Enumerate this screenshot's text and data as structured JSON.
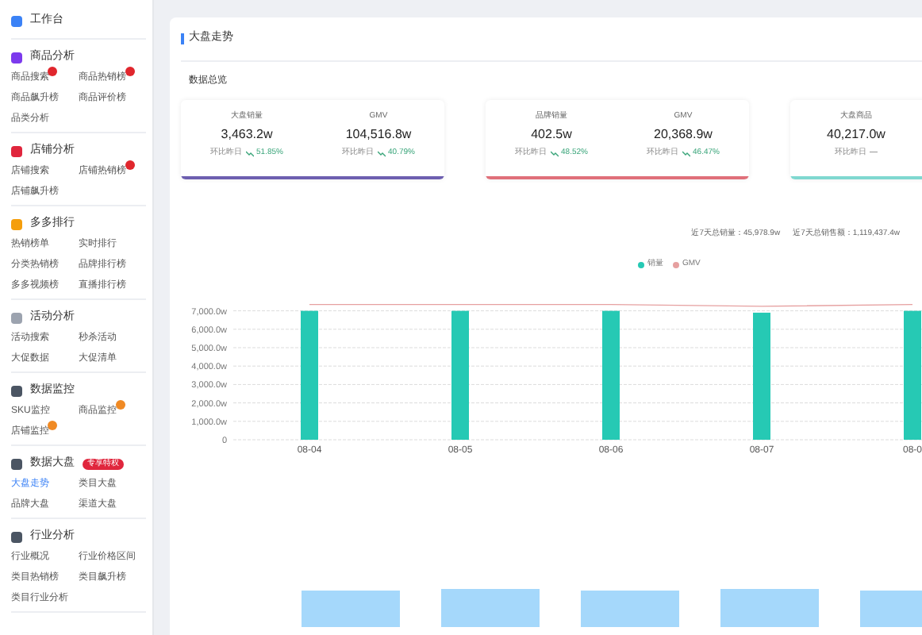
{
  "sidebar": {
    "sections": [
      {
        "title": "工作台"
      },
      {
        "title": "商品分析",
        "items": [
          {
            "label": "商品搜索",
            "selected": false,
            "color": "#e0262d"
          },
          {
            "label": "商品热销榜",
            "selected": false,
            "color": "#e0262d"
          },
          {
            "label": "商品飙升榜",
            "selected": false
          },
          {
            "label": "商品评价榜",
            "selected": false
          },
          {
            "label": "品类分析",
            "selected": false
          }
        ]
      },
      {
        "title": "店铺分析",
        "items": [
          {
            "label": "店铺搜索",
            "selected": false
          },
          {
            "label": "店铺热销榜",
            "selected": false,
            "color": "#e0262d"
          },
          {
            "label": "店铺飙升榜",
            "selected": false
          }
        ]
      },
      {
        "title": "多多排行",
        "items": [
          {
            "label": "热销榜单",
            "selected": false
          },
          {
            "label": "实时排行",
            "selected": false
          },
          {
            "label": "分类热销榜",
            "selected": false
          },
          {
            "label": "品牌排行榜",
            "selected": false
          },
          {
            "label": "多多视频榜",
            "selected": false
          },
          {
            "label": "直播排行榜",
            "selected": false
          }
        ]
      },
      {
        "title": "活动分析",
        "items": [
          {
            "label": "活动搜索",
            "selected": false
          },
          {
            "label": "秒杀活动",
            "selected": false
          },
          {
            "label": "大促数据",
            "selected": false
          },
          {
            "label": "大促清单",
            "selected": false
          }
        ]
      },
      {
        "title": "数据监控",
        "items": [
          {
            "label": "SKU监控",
            "selected": false
          },
          {
            "label": "商品监控",
            "selected": false,
            "color": "#f08a24"
          },
          {
            "label": "店铺监控",
            "selected": false,
            "color": "#f08a24"
          }
        ]
      },
      {
        "title": "数据大盘",
        "tag": "专享特权",
        "items": [
          {
            "label": "大盘走势",
            "selected": true
          },
          {
            "label": "类目大盘",
            "selected": false
          },
          {
            "label": "品牌大盘",
            "selected": false
          },
          {
            "label": "渠道大盘",
            "selected": false
          }
        ]
      },
      {
        "title": "行业分析",
        "items": [
          {
            "label": "行业概况",
            "selected": false
          },
          {
            "label": "行业价格区间",
            "selected": false
          },
          {
            "label": "类目热销榜",
            "selected": false
          },
          {
            "label": "类目飙升榜",
            "selected": false
          },
          {
            "label": "类目行业分析",
            "selected": false
          }
        ]
      }
    ]
  },
  "panel": {
    "title": "大盘走势",
    "subtitle": "数据总览",
    "cards": [
      {
        "color": "#6d5fb0",
        "stats": [
          {
            "label": "大盘销量",
            "value": "3,463.2w",
            "compare": "环比昨日",
            "change": "51.85%",
            "kind": "down"
          },
          {
            "label": "GMV",
            "value": "104,516.8w",
            "compare": "环比昨日",
            "change": "40.79%",
            "kind": "down"
          }
        ]
      },
      {
        "color": "#e0707a",
        "stats": [
          {
            "label": "品牌销量",
            "value": "402.5w",
            "compare": "环比昨日",
            "change": "48.52%",
            "kind": "down"
          },
          {
            "label": "GMV",
            "value": "20,368.9w",
            "compare": "环比昨日",
            "change": "46.47%",
            "kind": "down"
          }
        ]
      },
      {
        "color": "#7fd8d0",
        "stats": [
          {
            "label": "大盘商品",
            "value": "40,217.0w",
            "compare": "环比昨日",
            "change": "—",
            "kind": "flat"
          }
        ]
      }
    ],
    "totals": [
      "近7天总销量：45,978.9w",
      "近7天总销售额：1,119,437.4w"
    ],
    "line_legend": {
      "label": "GMV",
      "color": "#e6a0a0"
    },
    "chart_data": {
      "type": "bar",
      "grid": true,
      "categories": [
        "08-04",
        "08-05",
        "08-06",
        "08-07",
        "08-0"
      ],
      "series": [
        {
          "name": "销量",
          "color": "#26c9b4",
          "values": [
            7000,
            7000,
            7000,
            6900,
            7000
          ]
        }
      ],
      "ylim": [
        0,
        7000
      ],
      "yticks": [
        {
          "value": 0,
          "label": "0"
        },
        {
          "value": 1000,
          "label": "1,000.0w"
        },
        {
          "value": 2000,
          "label": "2,000.0w"
        },
        {
          "value": 3000,
          "label": "3,000.0w"
        },
        {
          "value": 4000,
          "label": "4,000.0w"
        },
        {
          "value": 5000,
          "label": "5,000.0w"
        },
        {
          "value": 6000,
          "label": "6,000.0w"
        },
        {
          "value": 7000,
          "label": "7,000.0w"
        }
      ]
    }
  }
}
